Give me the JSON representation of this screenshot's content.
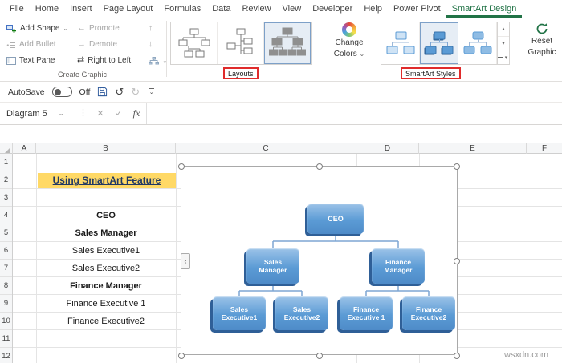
{
  "colors": {
    "accent_green": "#217346",
    "callout_red": "#e02b2b",
    "smartart_blue": "#5b9bd5",
    "title_highlight": "#ffd966"
  },
  "menu": {
    "tabs": [
      "File",
      "Home",
      "Insert",
      "Page Layout",
      "Formulas",
      "Data",
      "Review",
      "View",
      "Developer",
      "Help",
      "Power Pivot",
      "SmartArt Design"
    ],
    "active_tab": "SmartArt Design"
  },
  "ribbon": {
    "create_graphic": {
      "group_label": "Create Graphic",
      "add_shape": "Add Shape",
      "add_bullet": "Add Bullet",
      "text_pane": "Text Pane",
      "promote": "Promote",
      "demote": "Demote",
      "right_to_left": "Right to Left"
    },
    "layouts": {
      "group_label": "Layouts"
    },
    "smartart_styles": {
      "group_label": "SmartArt Styles",
      "change_colors_line1": "Change",
      "change_colors_line2": "Colors"
    },
    "reset": {
      "line1": "Reset",
      "line2": "Graphic"
    }
  },
  "quick_access": {
    "autosave_label": "AutoSave",
    "autosave_state": "Off"
  },
  "formula_bar": {
    "name_box_value": "Diagram 5",
    "fx_label": "fx"
  },
  "grid": {
    "columns": [
      "A",
      "B",
      "C",
      "D",
      "E",
      "F"
    ],
    "rows": [
      "1",
      "2",
      "3",
      "4",
      "5",
      "6",
      "7",
      "8",
      "9",
      "10",
      "11",
      "12"
    ]
  },
  "sheet": {
    "title": "Using SmartArt Feature",
    "entries": [
      "CEO",
      "Sales Manager",
      "Sales Executive1",
      "Sales Executive2",
      "Finance Manager",
      "Finance Executive 1",
      "Finance Executive2"
    ]
  },
  "diagram": {
    "nodes": {
      "ceo": "CEO",
      "sales_manager": "Sales Manager",
      "finance_manager": "Finance Manager",
      "sales_exec1": "Sales Executive1",
      "sales_exec2": "Sales Executive2",
      "finance_exec1": "Finance Executive 1",
      "finance_exec2": "Finance Executive2"
    }
  },
  "icons": {
    "caret_down": "⌄",
    "undo": "↺",
    "redo": "↻",
    "promote_arrow": "←",
    "demote_arrow": "→",
    "right_to_left": "⇄",
    "move_up": "↑",
    "move_down": "↓",
    "cancel": "✕",
    "enter": "✓",
    "name_box_dots": "⋮",
    "text_pane_toggle": "‹",
    "gallery_up": "▴",
    "gallery_down": "▾",
    "gallery_more": "▾"
  },
  "watermark": "wsxdn.com"
}
